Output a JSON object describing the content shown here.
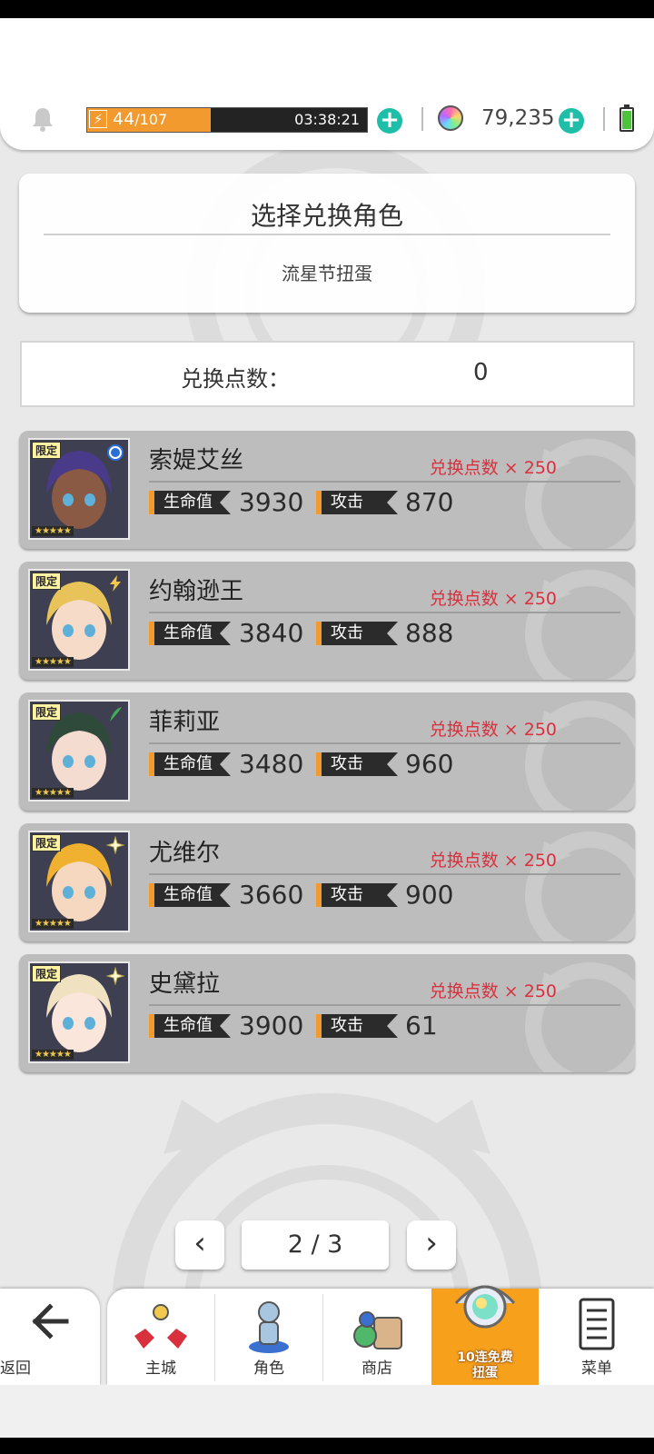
{
  "resources": {
    "stamina_current": "44",
    "stamina_max": "/107",
    "stamina_fraction": 0.44,
    "stamina_timer": "03:38:21",
    "gem_count": "79,235"
  },
  "title_card": {
    "title": "选择兑换角色",
    "subtitle": "流星节扭蛋"
  },
  "points": {
    "label": "兑换点数：",
    "value": "0"
  },
  "stat_labels": {
    "hp": "生命值",
    "atk": "攻击"
  },
  "characters": [
    {
      "name": "索媞艾丝",
      "cost": "兑换点数 × 250",
      "hp": "3930",
      "atk": "870",
      "limited": "限定",
      "element": "water-element-icon",
      "hair": "#4a3a8a",
      "skin": "#8a5a44"
    },
    {
      "name": "约翰逊王",
      "cost": "兑换点数 × 250",
      "hp": "3840",
      "atk": "888",
      "limited": "限定",
      "element": "lightning-element-icon",
      "hair": "#e8c35a",
      "skin": "#f6dcc8"
    },
    {
      "name": "菲莉亚",
      "cost": "兑换点数 × 250",
      "hp": "3480",
      "atk": "960",
      "limited": "限定",
      "element": "wind-element-icon",
      "hair": "#2f4a3a",
      "skin": "#f4dcd0"
    },
    {
      "name": "尤维尔",
      "cost": "兑换点数 × 250",
      "hp": "3660",
      "atk": "900",
      "limited": "限定",
      "element": "light-element-icon",
      "hair": "#f0b030",
      "skin": "#f6d8c0"
    },
    {
      "name": "史黛拉",
      "cost": "兑换点数 × 250",
      "hp": "3900",
      "atk": "61",
      "limited": "限定",
      "element": "light-element-icon",
      "hair": "#f0e2c0",
      "skin": "#fbe6dc"
    }
  ],
  "pagination": {
    "prev": "‹",
    "next": "›",
    "current": "2 / 3"
  },
  "nav": {
    "back": "返回",
    "main_city": "主城",
    "characters": "角色",
    "shop": "商店",
    "gacha_line1": "10连免费",
    "gacha_line2": "扭蛋",
    "menu": "菜单"
  },
  "colors": {
    "accent_orange": "#f29a2e",
    "cost_red": "#d8313d",
    "plus_teal": "#1fbea9",
    "card_gray": "#bdbdbe"
  }
}
